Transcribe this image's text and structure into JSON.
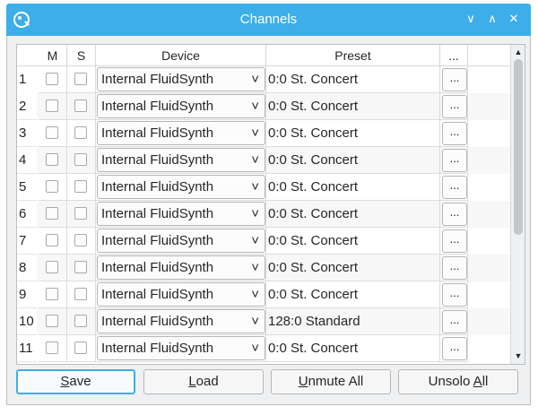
{
  "window": {
    "title": "Channels"
  },
  "titlebar_icons": {
    "app": "app-icon",
    "minimize": "chevron-down-icon",
    "maximize": "chevron-up-icon",
    "close": "close-icon"
  },
  "titlebar_glyphs": {
    "minimize": "∨",
    "maximize": "∧",
    "close": "✕"
  },
  "table": {
    "columns": [
      "M",
      "S",
      "Device",
      "Preset",
      "..."
    ],
    "rows": [
      {
        "num": "1",
        "muted": false,
        "solo": false,
        "device": "Internal FluidSynth",
        "preset": "0:0 St. Concert",
        "button": "..."
      },
      {
        "num": "2",
        "muted": false,
        "solo": false,
        "device": "Internal FluidSynth",
        "preset": "0:0 St. Concert",
        "button": "..."
      },
      {
        "num": "3",
        "muted": false,
        "solo": false,
        "device": "Internal FluidSynth",
        "preset": "0:0 St. Concert",
        "button": "..."
      },
      {
        "num": "4",
        "muted": false,
        "solo": false,
        "device": "Internal FluidSynth",
        "preset": "0:0 St. Concert",
        "button": "..."
      },
      {
        "num": "5",
        "muted": false,
        "solo": false,
        "device": "Internal FluidSynth",
        "preset": "0:0 St. Concert",
        "button": "..."
      },
      {
        "num": "6",
        "muted": false,
        "solo": false,
        "device": "Internal FluidSynth",
        "preset": "0:0 St. Concert",
        "button": "..."
      },
      {
        "num": "7",
        "muted": false,
        "solo": false,
        "device": "Internal FluidSynth",
        "preset": "0:0 St. Concert",
        "button": "..."
      },
      {
        "num": "8",
        "muted": false,
        "solo": false,
        "device": "Internal FluidSynth",
        "preset": "0:0 St. Concert",
        "button": "..."
      },
      {
        "num": "9",
        "muted": false,
        "solo": false,
        "device": "Internal FluidSynth",
        "preset": "0:0 St. Concert",
        "button": "..."
      },
      {
        "num": "10",
        "muted": false,
        "solo": false,
        "device": "Internal FluidSynth",
        "preset": "128:0 Standard",
        "button": "..."
      },
      {
        "num": "11",
        "muted": false,
        "solo": false,
        "device": "Internal FluidSynth",
        "preset": "0:0 St. Concert",
        "button": "..."
      }
    ]
  },
  "scrollbar": {
    "up_icon": "scroll-up-icon",
    "down_icon": "scroll-down-icon",
    "up_glyph": "▲",
    "down_glyph": "▼"
  },
  "buttons": [
    {
      "id": "save",
      "prefix": "",
      "mnemonic": "S",
      "rest": "ave"
    },
    {
      "id": "load",
      "prefix": "",
      "mnemonic": "L",
      "rest": "oad"
    },
    {
      "id": "unmute",
      "prefix": "",
      "mnemonic": "U",
      "rest": "nmute All"
    },
    {
      "id": "unsolo",
      "prefix": "Unsolo ",
      "mnemonic": "A",
      "rest": "ll"
    }
  ],
  "colors": {
    "accent": "#3daee9",
    "window_bg": "#eff0f1",
    "text": "#232629"
  }
}
